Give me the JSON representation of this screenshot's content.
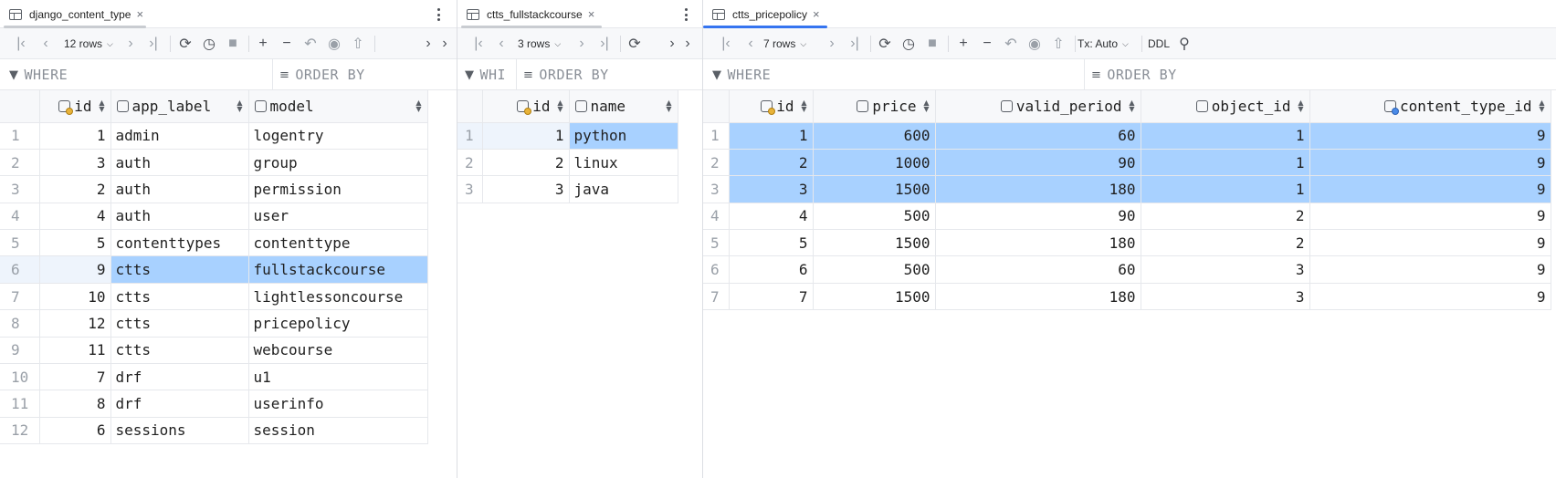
{
  "colors": {
    "accent": "#3574f0",
    "tab_underline_inactive": "#c9ccd1",
    "selection": "#a8d1ff"
  },
  "panes": [
    {
      "table_name": "django_content_type",
      "rows_label": "12 rows",
      "filters": {
        "where": "WHERE",
        "order_by": "ORDER BY"
      },
      "columns": [
        {
          "label": "id",
          "icon": "primary-key-column-icon"
        },
        {
          "label": "app_label",
          "icon": "column-icon"
        },
        {
          "label": "model",
          "icon": "column-icon"
        }
      ],
      "rows": [
        [
          "1",
          "1",
          "admin",
          "logentry"
        ],
        [
          "2",
          "3",
          "auth",
          "group"
        ],
        [
          "3",
          "2",
          "auth",
          "permission"
        ],
        [
          "4",
          "4",
          "auth",
          "user"
        ],
        [
          "5",
          "5",
          "contenttypes",
          "contenttype"
        ],
        [
          "6",
          "9",
          "ctts",
          "fullstackcourse"
        ],
        [
          "7",
          "10",
          "ctts",
          "lightlessoncourse"
        ],
        [
          "8",
          "12",
          "ctts",
          "pricepolicy"
        ],
        [
          "9",
          "11",
          "ctts",
          "webcourse"
        ],
        [
          "10",
          "7",
          "drf",
          "u1"
        ],
        [
          "11",
          "8",
          "drf",
          "userinfo"
        ],
        [
          "12",
          "6",
          "sessions",
          "session"
        ]
      ]
    },
    {
      "table_name": "ctts_fullstackcourse",
      "rows_label": "3 rows",
      "filters": {
        "where": "WHI",
        "order_by": "ORDER BY"
      },
      "columns": [
        {
          "label": "id",
          "icon": "primary-key-column-icon"
        },
        {
          "label": "name",
          "icon": "column-icon"
        }
      ],
      "rows": [
        [
          "1",
          "1",
          "python"
        ],
        [
          "2",
          "2",
          "linux"
        ],
        [
          "3",
          "3",
          "java"
        ]
      ]
    },
    {
      "table_name": "ctts_pricepolicy",
      "rows_label": "7 rows",
      "tx_label": "Tx: Auto",
      "ddl_label": "DDL",
      "filters": {
        "where": "WHERE",
        "order_by": "ORDER BY"
      },
      "columns": [
        {
          "label": "id",
          "icon": "primary-key-column-icon"
        },
        {
          "label": "price",
          "icon": "column-icon"
        },
        {
          "label": "valid_period",
          "icon": "column-icon"
        },
        {
          "label": "object_id",
          "icon": "column-icon"
        },
        {
          "label": "content_type_id",
          "icon": "foreign-key-column-icon"
        }
      ],
      "rows": [
        [
          "1",
          "1",
          "600",
          "60",
          "1",
          "9"
        ],
        [
          "2",
          "2",
          "1000",
          "90",
          "1",
          "9"
        ],
        [
          "3",
          "3",
          "1500",
          "180",
          "1",
          "9"
        ],
        [
          "4",
          "4",
          "500",
          "90",
          "2",
          "9"
        ],
        [
          "5",
          "5",
          "1500",
          "180",
          "2",
          "9"
        ],
        [
          "6",
          "6",
          "500",
          "60",
          "3",
          "9"
        ],
        [
          "7",
          "7",
          "1500",
          "180",
          "3",
          "9"
        ]
      ]
    }
  ]
}
